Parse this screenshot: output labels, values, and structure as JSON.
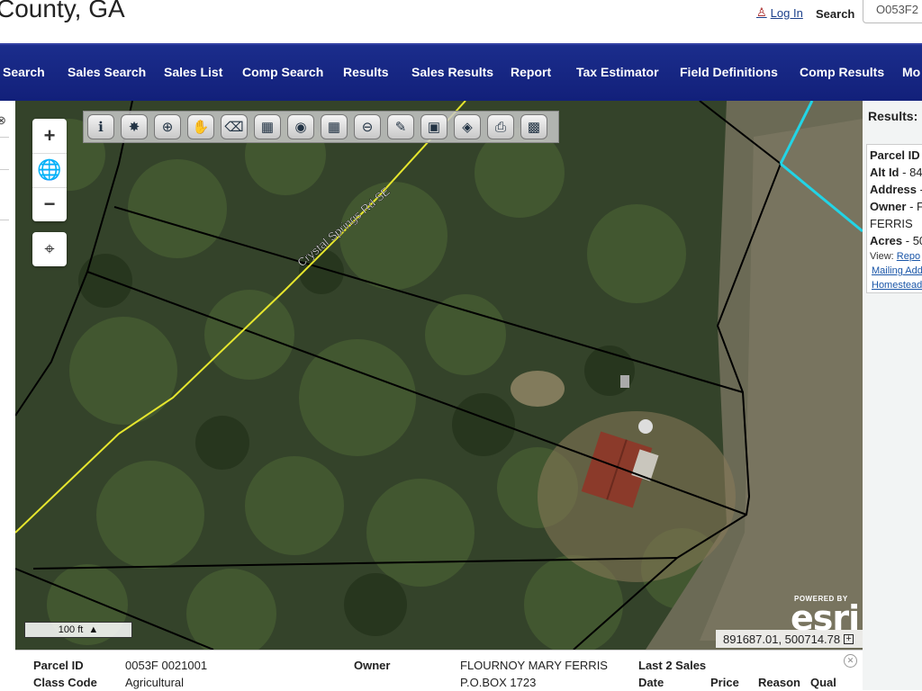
{
  "header": {
    "county_title": "County, GA",
    "login_label": "Log In",
    "search_label": "Search",
    "search_value": "O053F2"
  },
  "nav": {
    "items": [
      "Search",
      "Sales Search",
      "Sales List",
      "Comp Search",
      "Results",
      "Sales Results",
      "Report",
      "Tax Estimator",
      "Field Definitions",
      "Comp Results",
      "Mo"
    ]
  },
  "map": {
    "road_label": "Crystal Springs Rd SE",
    "scale_label": "100 ft",
    "coordinates": "891687.01, 500714.78",
    "esri_powered": "POWERED BY",
    "esri_logo": "esri",
    "toolbar_icons": [
      "info-icon",
      "identify-icon",
      "zoom-in-tool-icon",
      "pan-hand-icon",
      "eraser-icon",
      "select-icon",
      "buffer-icon",
      "measure-icon",
      "zoom-out-tool-icon",
      "draw-pencil-icon",
      "print-map-icon",
      "layers-icon",
      "printer-icon",
      "save-icon"
    ],
    "colors": {
      "road": "#e6e62e",
      "parcel_line": "#000000",
      "highlight_line": "#22d4e6"
    }
  },
  "results": {
    "title": "Results:",
    "parcel_id_label": "Parcel ID",
    "alt_id_label": "Alt Id",
    "alt_id_value": "- 84",
    "address_label": "Address",
    "address_value": "-",
    "owner_label": "Owner",
    "owner_value": "- F",
    "owner_line2": "FERRIS",
    "acres_label": "Acres",
    "acres_value": "- 50",
    "view_label": "View:",
    "view_link": "Repo",
    "mailing_link": "Mailing Add",
    "homestead_link": "Homestead"
  },
  "bottom": {
    "parcel_id_label": "Parcel ID",
    "parcel_id_value": "0053F 0021001",
    "class_code_label": "Class Code",
    "class_code_value": "Agricultural",
    "owner_label": "Owner",
    "owner_name": "FLOURNOY MARY FERRIS",
    "owner_address": "P.O.BOX 1723",
    "last_sales_label": "Last 2 Sales",
    "date_label": "Date",
    "price_label": "Price",
    "reason_label": "Reason",
    "qual_label": "Qual"
  }
}
